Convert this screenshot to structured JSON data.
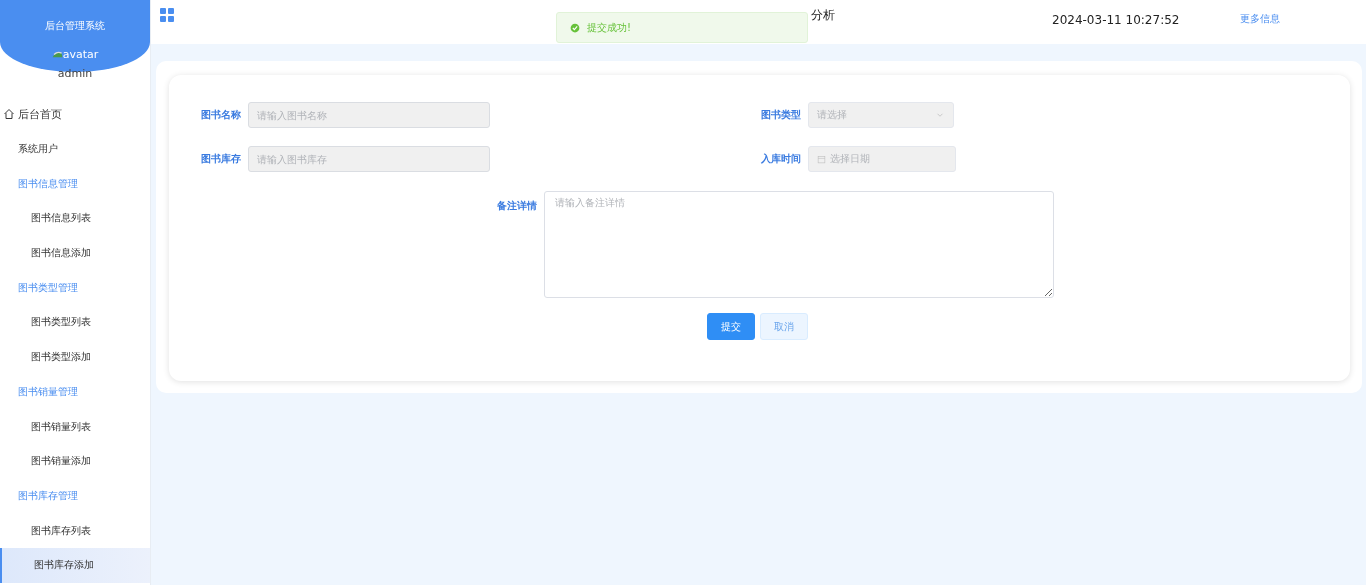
{
  "sidebar": {
    "title": "后台管理系统",
    "avatar_alt": "avatar",
    "user": "admin",
    "items": [
      {
        "label": "后台首页",
        "kind": "home",
        "selected": false
      },
      {
        "label": "系统用户",
        "kind": "item",
        "selected": false
      },
      {
        "label": "图书信息管理",
        "kind": "group",
        "children": [
          {
            "label": "图书信息列表",
            "selected": false
          },
          {
            "label": "图书信息添加",
            "selected": false
          }
        ]
      },
      {
        "label": "图书类型管理",
        "kind": "group",
        "children": [
          {
            "label": "图书类型列表",
            "selected": false
          },
          {
            "label": "图书类型添加",
            "selected": false
          }
        ]
      },
      {
        "label": "图书销量管理",
        "kind": "group",
        "children": [
          {
            "label": "图书销量列表",
            "selected": false
          },
          {
            "label": "图书销量添加",
            "selected": false
          }
        ]
      },
      {
        "label": "图书库存管理",
        "kind": "group",
        "children": [
          {
            "label": "图书库存列表",
            "selected": false
          },
          {
            "label": "图书库存添加",
            "selected": true
          }
        ]
      }
    ]
  },
  "header": {
    "title": "分析",
    "datetime": "2024-03-11 10:27:52",
    "more_link": "更多信息"
  },
  "toast": {
    "message": "提交成功!"
  },
  "form": {
    "fields": [
      {
        "label": "图书名称",
        "kind": "text",
        "placeholder": "请输入图书名称"
      },
      {
        "label": "图书类型",
        "kind": "select",
        "placeholder": "请选择"
      },
      {
        "label": "图书库存",
        "kind": "text",
        "placeholder": "请输入图书库存"
      },
      {
        "label": "入库时间",
        "kind": "date",
        "placeholder": "选择日期"
      },
      {
        "label": "备注详情",
        "kind": "textarea",
        "placeholder": "请输入备注详情"
      }
    ],
    "buttons": [
      {
        "label": "提交",
        "kind": "primary"
      },
      {
        "label": "取消",
        "kind": "plain"
      }
    ]
  }
}
